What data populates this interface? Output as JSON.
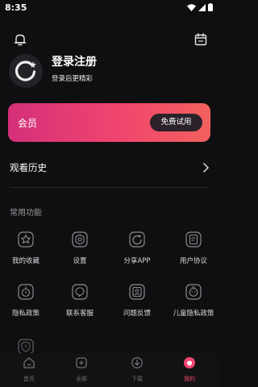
{
  "status_bar": {
    "time": "8:35"
  },
  "profile": {
    "title": "登录注册",
    "subtitle": "登录后更精彩"
  },
  "vip": {
    "label": "会员",
    "button": "免费试用"
  },
  "history": {
    "label": "观看历史"
  },
  "features": {
    "title": "常用功能",
    "items": [
      {
        "label": "我的收藏",
        "icon": "star-icon"
      },
      {
        "label": "设置",
        "icon": "settings-icon"
      },
      {
        "label": "分享APP",
        "icon": "share-icon"
      },
      {
        "label": "用户协议",
        "icon": "document-icon"
      },
      {
        "label": "隐私政策",
        "icon": "privacy-icon"
      },
      {
        "label": "联系客服",
        "icon": "customer-service-icon"
      },
      {
        "label": "问题反馈",
        "icon": "feedback-icon"
      },
      {
        "label": "儿童隐私政策",
        "icon": "child-privacy-icon"
      }
    ]
  },
  "bottom_nav": {
    "items": [
      {
        "label": "首页",
        "icon": "home-icon"
      },
      {
        "label": "全部",
        "icon": "all-icon"
      },
      {
        "label": "下载",
        "icon": "download-icon"
      },
      {
        "label": "我的",
        "icon": "profile-icon",
        "active": true
      }
    ]
  },
  "colors": {
    "accent": "#f0456e",
    "background": "#0f0f11"
  }
}
